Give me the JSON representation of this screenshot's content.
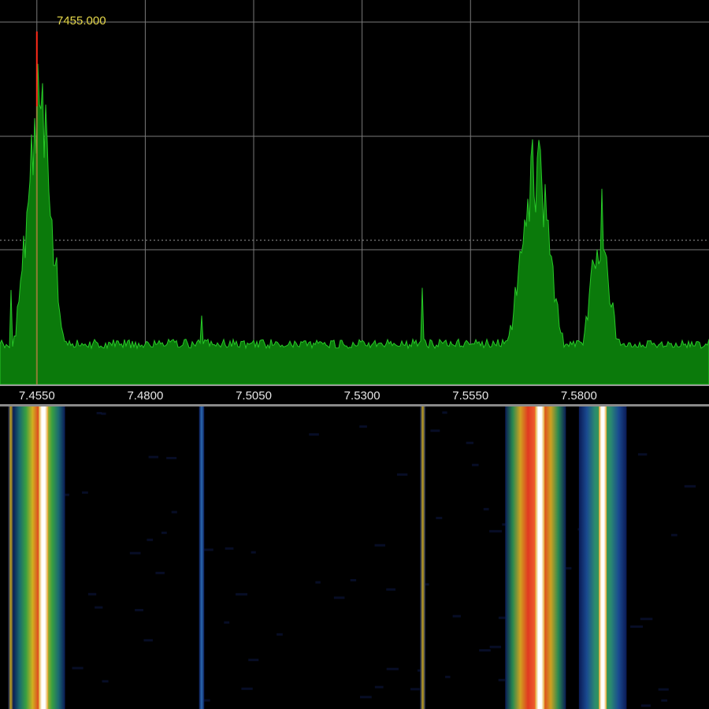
{
  "marker": {
    "frequency_label": "7455.000",
    "frequency_mhz": 7.455,
    "color": "#ff2a1a",
    "label_color": "#e6d84a"
  },
  "axis": {
    "min_mhz": 7.4465,
    "max_mhz": 7.61,
    "ticks": [
      "7.4550",
      "7.4800",
      "7.5050",
      "7.5300",
      "7.5550",
      "7.5800"
    ],
    "tick_values": [
      7.455,
      7.48,
      7.505,
      7.53,
      7.555,
      7.58
    ]
  },
  "colors": {
    "spectrum_fill": "#0b7a0b",
    "spectrum_line": "#28c828",
    "grid": "#7a7a7a",
    "background": "#000000"
  },
  "signals": [
    {
      "center_mhz": 7.4555,
      "width_mhz": 0.006,
      "peak": 0.8,
      "type": "broad"
    },
    {
      "center_mhz": 7.4565,
      "width_mhz": 0.0008,
      "peak": 0.72,
      "type": "narrow"
    },
    {
      "center_mhz": 7.449,
      "width_mhz": 0.0004,
      "peak": 0.27,
      "type": "narrow"
    },
    {
      "center_mhz": 7.493,
      "width_mhz": 0.0006,
      "peak": 0.19,
      "type": "narrow"
    },
    {
      "center_mhz": 7.544,
      "width_mhz": 0.0004,
      "peak": 0.36,
      "type": "narrow"
    },
    {
      "center_mhz": 7.57,
      "width_mhz": 0.007,
      "peak": 0.62,
      "type": "broad"
    },
    {
      "center_mhz": 7.571,
      "width_mhz": 0.0007,
      "peak": 0.71,
      "type": "narrow"
    },
    {
      "center_mhz": 7.585,
      "width_mhz": 0.005,
      "peak": 0.4,
      "type": "broad"
    },
    {
      "center_mhz": 7.5853,
      "width_mhz": 0.0006,
      "peak": 0.54,
      "type": "narrow"
    }
  ]
}
